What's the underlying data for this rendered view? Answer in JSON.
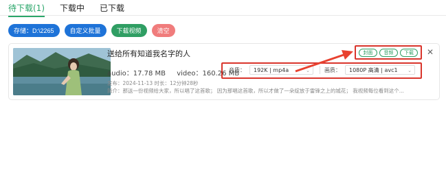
{
  "tabs": [
    {
      "label": "待下载(1)"
    },
    {
      "label": "下载中"
    },
    {
      "label": "已下载"
    }
  ],
  "toolbar": {
    "storage_label": "存储：D:\\2265",
    "custom_batch_label": "自定义批量",
    "download_video_label": "下载视频",
    "clear_label": "清空"
  },
  "item": {
    "title": "送给所有知道我名字的人",
    "audio_size": "audio：17.78 MB",
    "video_size": "video：160.26 MB",
    "meta": "发布：2024-11-13  时长：12分钟28秒",
    "description": "简介：那送一份视频给大家，所以唱了这首歌； 因为那唱这首歌，所以才做了一朵绽放于雷锋之上的城花； 我视频每位看到这个...",
    "audio_quality_label": "音质：",
    "audio_quality_value": "192K | mp4a",
    "video_quality_label": "画质：",
    "video_quality_value": "1080P 高清 | avc1",
    "cover_label": "封面",
    "audio_label": "音频",
    "download_label": "下载"
  },
  "colors": {
    "accent_green": "#2aa66a",
    "button_blue": "#1e73d8",
    "button_red": "#f07c7c",
    "highlight_red": "#d9342b"
  }
}
